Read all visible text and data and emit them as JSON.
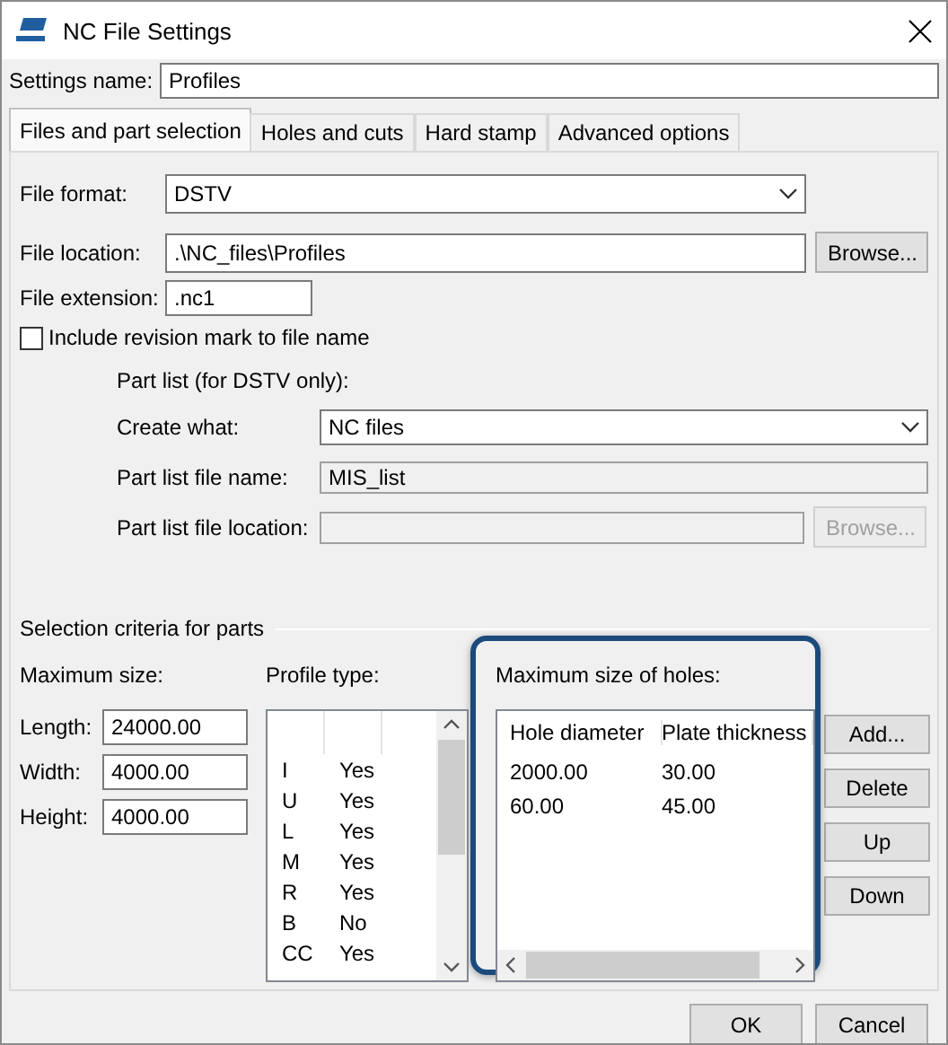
{
  "window": {
    "title": "NC File Settings"
  },
  "settings_name": {
    "label": "Settings name:",
    "value": "Profiles"
  },
  "tabs": [
    {
      "label": "Files and part selection",
      "selected": true
    },
    {
      "label": "Holes and cuts",
      "selected": false
    },
    {
      "label": "Hard stamp",
      "selected": false
    },
    {
      "label": "Advanced options",
      "selected": false
    }
  ],
  "file_format": {
    "label": "File format:",
    "value": "DSTV"
  },
  "file_location": {
    "label": "File location:",
    "value": ".\\NC_files\\Profiles",
    "button": "Browse..."
  },
  "file_extension": {
    "label": "File extension:",
    "value": ".nc1"
  },
  "revision_mark": {
    "label": "Include revision mark to file name",
    "checked": false
  },
  "part_list": {
    "heading": "Part list (for DSTV only):",
    "create_what": {
      "label": "Create what:",
      "value": "NC files"
    },
    "file_name": {
      "label": "Part list file name:",
      "value": "MIS_list",
      "disabled": true
    },
    "file_location": {
      "label": "Part list file location:",
      "disabled": true,
      "button": "Browse...",
      "button_disabled": true
    }
  },
  "selection_criteria": {
    "title": "Selection criteria for parts",
    "maximum_size": {
      "heading": "Maximum size:",
      "fields": [
        {
          "label": "Length:",
          "value": "24000.00"
        },
        {
          "label": "Width:",
          "value": "4000.00"
        },
        {
          "label": "Height:",
          "value": "4000.00"
        }
      ]
    },
    "profile_type": {
      "heading": "Profile type:",
      "rows": [
        [
          "I",
          "Yes"
        ],
        [
          "U",
          "Yes"
        ],
        [
          "L",
          "Yes"
        ],
        [
          "M",
          "Yes"
        ],
        [
          "R",
          "Yes"
        ],
        [
          "B",
          "No"
        ],
        [
          "CC",
          "Yes"
        ]
      ]
    },
    "holes": {
      "heading": "Maximum size of holes:",
      "columns": [
        "Hole diameter",
        "Plate thickness"
      ],
      "rows": [
        [
          "2000.00",
          "30.00"
        ],
        [
          "60.00",
          "45.00"
        ]
      ]
    },
    "buttons": [
      "Add...",
      "Delete",
      "Up",
      "Down"
    ]
  },
  "buttons": [
    "OK",
    "Cancel"
  ]
}
